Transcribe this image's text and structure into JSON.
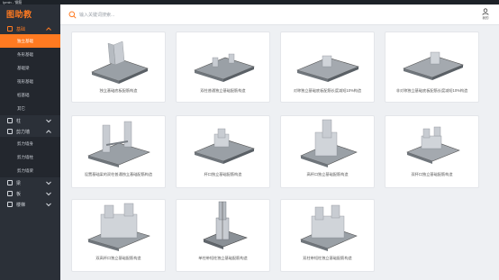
{
  "window": {
    "title": "Ipmin - 钢筋"
  },
  "brand": {
    "logo_text": "图助教"
  },
  "search": {
    "placeholder": "输入关键词搜索..."
  },
  "user": {
    "label": "我的"
  },
  "accent": "#ff7a21",
  "sidebar": {
    "groups": [
      {
        "label": "基础",
        "icon": "foundation-icon",
        "expanded": true,
        "items": [
          "独立基础",
          "条形基础",
          "基础梁",
          "筏形基础",
          "桩基础",
          "其它"
        ]
      },
      {
        "label": "柱",
        "icon": "column-icon",
        "expanded": false
      },
      {
        "label": "剪力墙",
        "icon": "shear-wall-icon",
        "expanded": true,
        "items": [
          "剪力墙身",
          "剪力墙柱",
          "剪力墙梁"
        ]
      },
      {
        "label": "梁",
        "icon": "beam-icon",
        "expanded": false
      },
      {
        "label": "板",
        "icon": "slab-icon",
        "expanded": false
      },
      {
        "label": "楼梯",
        "icon": "stair-icon",
        "expanded": false
      }
    ]
  },
  "cards": [
    {
      "label": "独立基础底板配筋构造"
    },
    {
      "label": "双柱普通独立基础配筋构造"
    },
    {
      "label": "对称独立基础底板配筋长度减短10%构造"
    },
    {
      "label": "非对称独立基础底板配筋长度减短10%构造"
    },
    {
      "label": "设置基础梁的双柱普通独立基础配筋构造"
    },
    {
      "label": "杯口独立基础配筋构造"
    },
    {
      "label": "高杯口独立基础配筋构造"
    },
    {
      "label": "双杯口独立基础配筋构造"
    },
    {
      "label": "双高杯口独立基础配筋构造"
    },
    {
      "label": "单柱带短柱独立基础配筋构造"
    },
    {
      "label": "双柱带短柱独立基础配筋构造"
    }
  ]
}
